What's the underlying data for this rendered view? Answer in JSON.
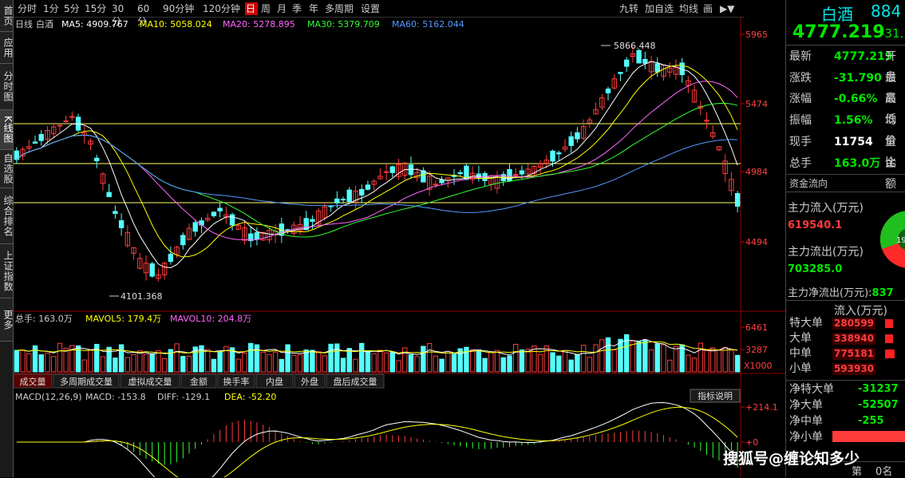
{
  "side_tabs": [
    {
      "name": "home",
      "label": "首页"
    },
    {
      "name": "app",
      "label": "应用"
    },
    {
      "name": "timeshare",
      "label": "分时图"
    },
    {
      "name": "kline",
      "label": "K线图"
    },
    {
      "name": "watchlist",
      "label": "自选股"
    },
    {
      "name": "rank",
      "label": "综合排名"
    },
    {
      "name": "index",
      "label": "上证指数"
    },
    {
      "name": "more",
      "label": "更多"
    }
  ],
  "periods": [
    "分时",
    "1分",
    "5分",
    "15分",
    "30分",
    "60分",
    "90分钟",
    "120分钟",
    "日",
    "周",
    "月",
    "季",
    "年",
    "多周期",
    "设置"
  ],
  "active_period": "日",
  "tools": [
    "九转",
    "加自选",
    "均线",
    "画"
  ],
  "ma_line": {
    "period": "日线",
    "name": "白酒",
    "ma5": "MA5: 4909.767",
    "ma10": "MA10: 5058.024",
    "ma20": "MA20: 5278.895",
    "ma30": "MA30: 5379.709",
    "ma60": "MA60: 5162.044"
  },
  "price_axis": {
    "values": [
      "5965",
      "5474",
      "4984",
      "4494"
    ]
  },
  "annotations": {
    "high": "5866.448",
    "low": "4101.368"
  },
  "vol_line": {
    "label": "总手: 163.0万",
    "mavol5": "MAVOL5: 179.4万",
    "mavol10": "MAVOL10: 204.8万"
  },
  "vol_axis": {
    "values": [
      "6461",
      "3287"
    ],
    "unit": "X1000"
  },
  "vol_tabs": [
    "成交量",
    "多周期成交量",
    "虚拟成交量",
    "金额",
    "换手率",
    "内盘",
    "外盘",
    "盘后成交量"
  ],
  "macd_line": {
    "label": "MACD(12,26,9)",
    "macd": "MACD: -153.8",
    "diff": "DIFF: -129.1",
    "dea": "DEA: -52.20"
  },
  "macd_axis": {
    "top": "+214.1",
    "zero": "+0"
  },
  "macd_button": "指标说明",
  "right_panel": {
    "title": "白酒",
    "code": "884",
    "price": "4777.219",
    "change_small": "-31.",
    "rows": [
      {
        "k": "最新",
        "v": "4777.219",
        "k2": "开盘",
        "color": "green"
      },
      {
        "k": "涨跌",
        "v": "-31.790",
        "k2": "最高",
        "color": "green"
      },
      {
        "k": "涨幅",
        "v": "-0.66%",
        "k2": "最低",
        "color": "green"
      },
      {
        "k": "振幅",
        "v": "1.56%",
        "k2": "均价",
        "color": "green"
      },
      {
        "k": "现手",
        "v": "11754",
        "k2": "量比",
        "color": "white"
      },
      {
        "k": "总手",
        "v": "163.0万",
        "k2": "金额",
        "color": "green"
      }
    ],
    "fund_title": "资金流向",
    "main_in_label": "主力流入(万元)",
    "main_in_value": "619540.1",
    "main_out_label": "主力流出(万元)",
    "main_out_value": "703285.0",
    "main_net_label": "主力净流出(万元):",
    "main_net_value": "837",
    "pie_label": "19",
    "flow_header": "流入(万元)",
    "flow_rows": [
      {
        "k": "特大单",
        "v": "280599"
      },
      {
        "k": "大单",
        "v": "338940"
      },
      {
        "k": "中单",
        "v": "775181"
      },
      {
        "k": "小单",
        "v": "593930"
      }
    ],
    "net_rows": [
      {
        "k": "净特大单",
        "v": "-31237"
      },
      {
        "k": "净大单",
        "v": "-52507"
      },
      {
        "k": "净中单",
        "v": "-255"
      },
      {
        "k": "净小单",
        "v": ""
      }
    ],
    "bottom_left": "第",
    "bottom_right": "0名"
  },
  "watermark": "搜狐号@缠论知多少",
  "colors": {
    "up": "#ff3c3c",
    "down": "#54ffff",
    "ma5": "#ffffff",
    "ma10": "#ffff00",
    "ma20": "#ff66ff",
    "ma30": "#33ff33",
    "ma60": "#5599ff",
    "hline": "#ffff66"
  }
}
